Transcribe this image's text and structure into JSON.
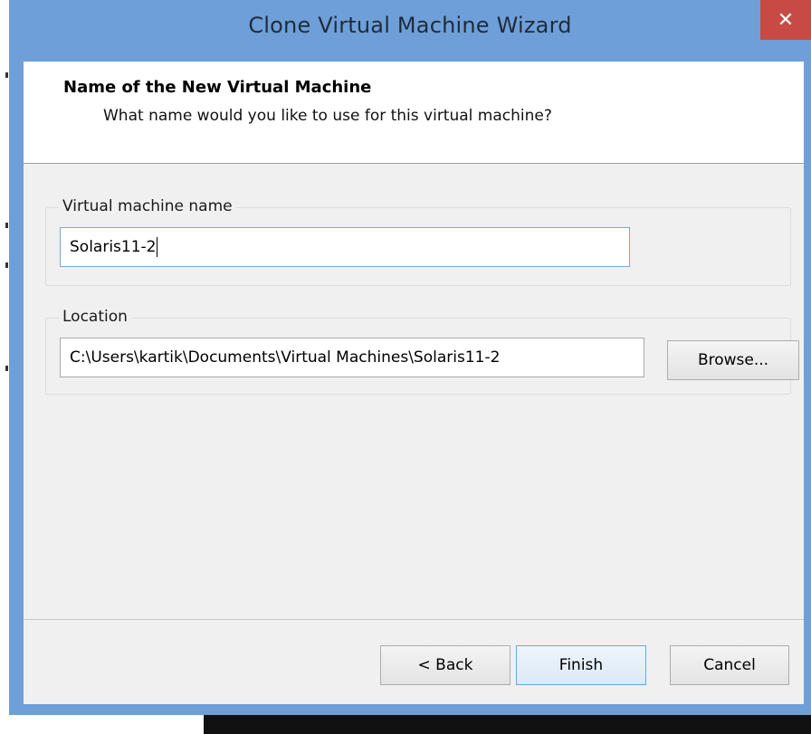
{
  "window": {
    "title": "Clone Virtual Machine Wizard",
    "close_glyph": "✕"
  },
  "header": {
    "title": "Name of the New Virtual Machine",
    "subtitle": "What name would you like to use for this virtual machine?"
  },
  "vm_name": {
    "label": "Virtual machine name",
    "value": "Solaris11-2"
  },
  "location": {
    "label": "Location",
    "value": "C:\\Users\\kartik\\Documents\\Virtual Machines\\Solaris11-2",
    "browse_label": "Browse..."
  },
  "footer": {
    "back_label": "< Back",
    "finish_label": "Finish",
    "cancel_label": "Cancel"
  },
  "colors": {
    "frame": "#6f9fd8",
    "close_button": "#c74b44",
    "client": "#f0f0f0"
  }
}
